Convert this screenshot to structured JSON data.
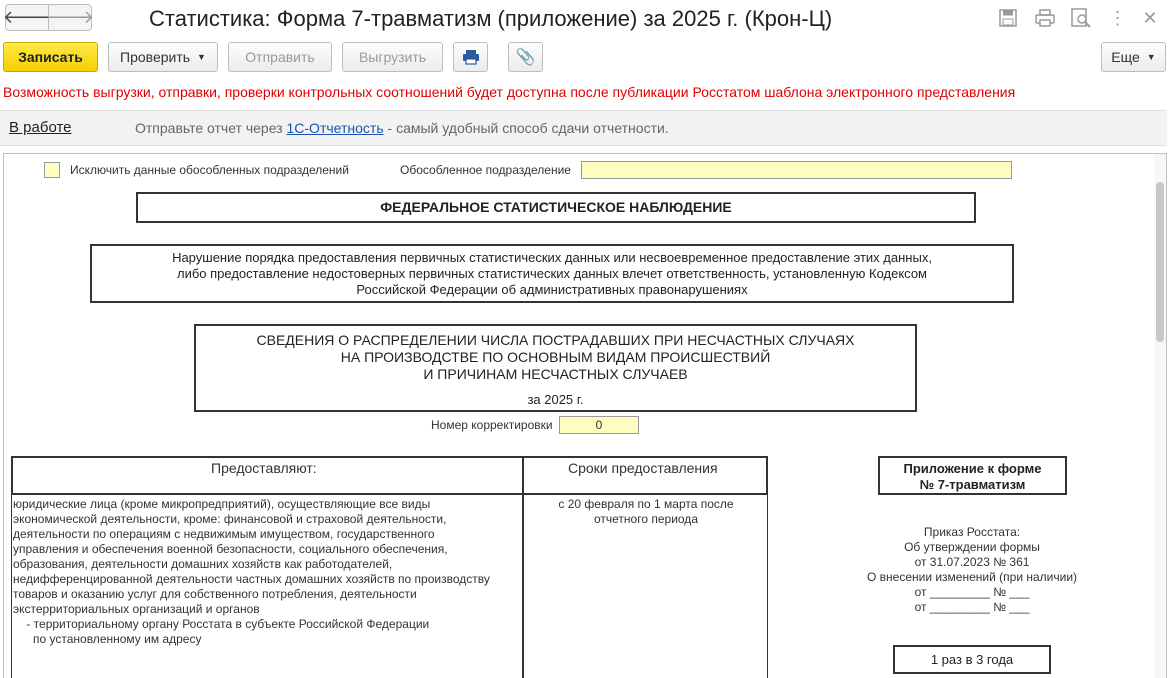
{
  "window": {
    "title": "Статистика: Форма 7-травматизм (приложение) за 2025 г. (Крон-Ц)"
  },
  "toolbar": {
    "record": "Записать",
    "check": "Проверить",
    "send": "Отправить",
    "unload": "Выгрузить",
    "more": "Еще"
  },
  "warning": "Возможность выгрузки, отправки, проверки контрольных соотношений будет доступна после публикации Росстатом шаблона электронного представления",
  "status": {
    "label": "В работе",
    "text_before": "Отправьте отчет через",
    "link": "1С-Отчетность",
    "text_after": "- самый удобный способ сдачи отчетности."
  },
  "form": {
    "exclude_label": "Исключить данные обособленных подразделений",
    "subdivision_label": "Обособленное подразделение",
    "subdivision_value": "",
    "federal": "ФЕДЕРАЛЬНОЕ СТАТИСТИЧЕСКОЕ НАБЛЮДЕНИЕ",
    "warning_lines": [
      "Нарушение порядка предоставления первичных статистических данных или несвоевременное предоставление этих данных,",
      "либо предоставление недостоверных первичных статистических данных влечет ответственность, установленную Кодексом",
      "Российской Федерации об административных правонарушениях"
    ],
    "heading_lines": [
      "СВЕДЕНИЯ О РАСПРЕДЕЛЕНИИ ЧИСЛА ПОСТРАДАВШИХ ПРИ НЕСЧАСТНЫХ СЛУЧАЯХ",
      "НА ПРОИЗВОДСТВЕ ПО ОСНОВНЫМ ВИДАМ ПРОИСШЕСТВИЙ",
      "И ПРИЧИНАМ НЕСЧАСТНЫХ СЛУЧАЕВ"
    ],
    "period": "за 2025 г.",
    "correction_label": "Номер корректировки",
    "correction_value": "0",
    "table": {
      "col1_header": "Предоставляют:",
      "col2_header": "Сроки предоставления",
      "col1_lines": [
        "юридические лица (кроме микропредприятий), осуществляющие все виды",
        "экономической деятельности, кроме: финансовой и страховой деятельности,",
        "деятельности по операциям с недвижимым имуществом, государственного",
        "управления и обеспечения военной безопасности, социального обеспечения,",
        "образования, деятельности домашних хозяйств как работодателей,",
        "недифференцированной деятельности частных домашних хозяйств по производству",
        "товаров и оказанию услуг для собственного потребления, деятельности",
        "экстерриториальных организаций и органов",
        "    - территориальному органу Росстата в субъекте Российской Федерации",
        "      по установленному им адресу"
      ],
      "col2_lines": [
        "с 20 февраля по 1 марта после",
        "отчетного периода"
      ]
    },
    "appendix_lines": [
      "Приложение к форме",
      "№ 7-травматизм"
    ],
    "order_lines": [
      "Приказ Росстата:",
      "Об утверждении формы",
      "от 31.07.2023 № 361",
      "О внесении изменений (при наличии)",
      "от _________ № ___",
      "от _________ № ___"
    ],
    "frequency": "1 раз в 3 года"
  }
}
